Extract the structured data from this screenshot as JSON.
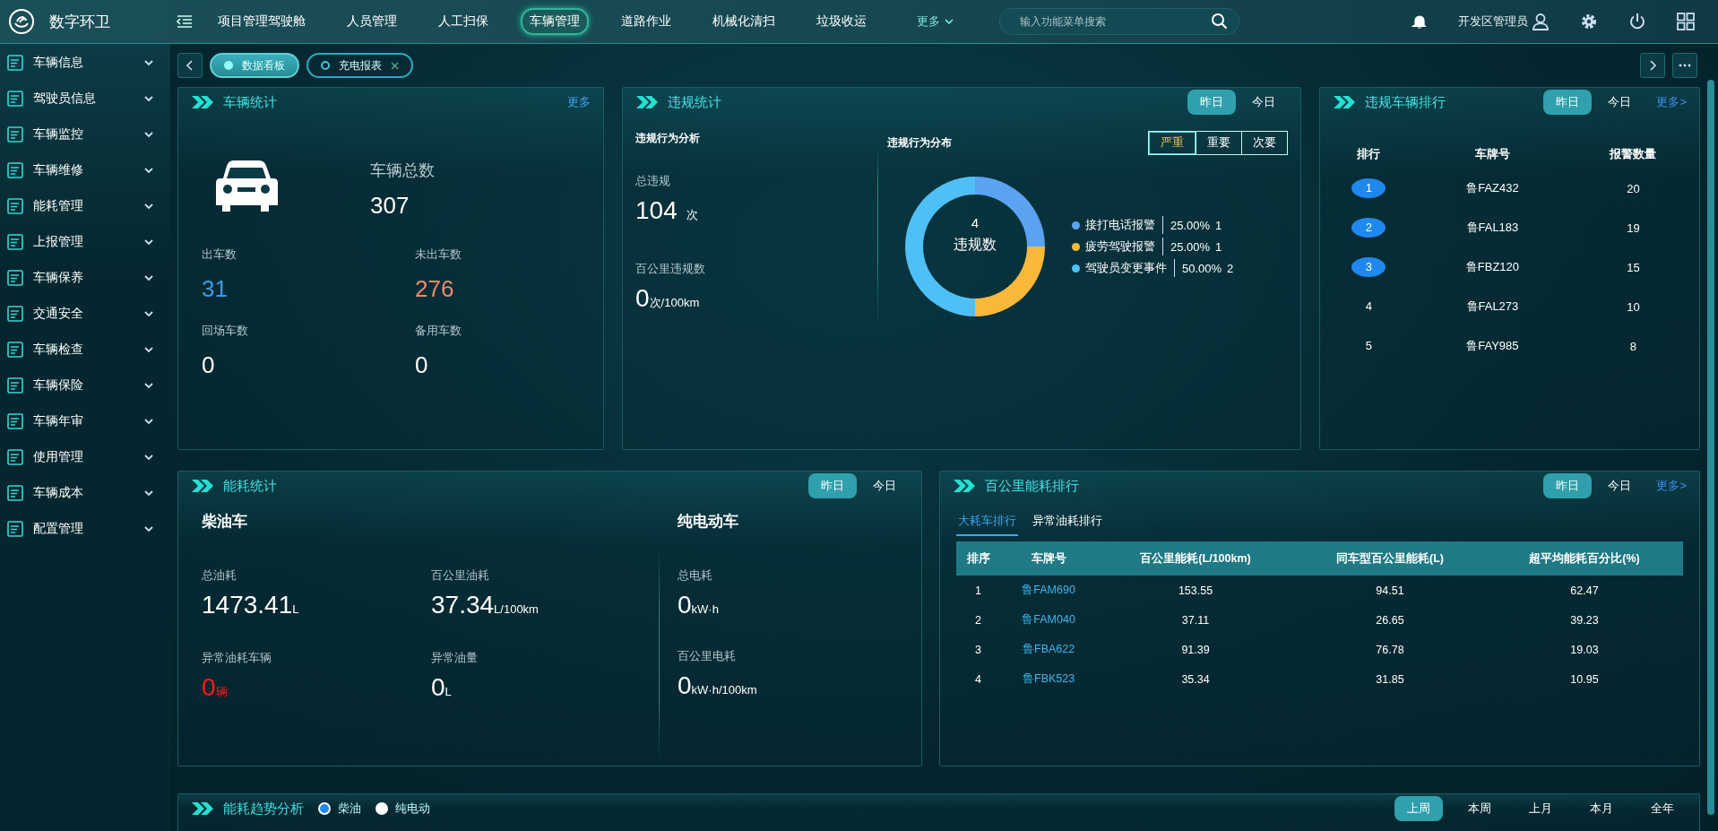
{
  "header": {
    "app_name": "数字环卫",
    "nav": [
      {
        "label": "项目管理驾驶舱",
        "selected": false
      },
      {
        "label": "人员管理",
        "selected": false
      },
      {
        "label": "人工扫保",
        "selected": false
      },
      {
        "label": "车辆管理",
        "selected": true
      },
      {
        "label": "道路作业",
        "selected": false
      },
      {
        "label": "机械化清扫",
        "selected": false
      },
      {
        "label": "垃圾收运",
        "selected": false
      }
    ],
    "more": "更多",
    "search": {
      "placeholder": "输入功能菜单搜索"
    },
    "user": "开发区管理员"
  },
  "sidebar": {
    "items": [
      {
        "label": "车辆信息"
      },
      {
        "label": "驾驶员信息"
      },
      {
        "label": "车辆监控"
      },
      {
        "label": "车辆维修"
      },
      {
        "label": "能耗管理"
      },
      {
        "label": "上报管理"
      },
      {
        "label": "车辆保养"
      },
      {
        "label": "交通安全"
      },
      {
        "label": "车辆检查"
      },
      {
        "label": "车辆保险"
      },
      {
        "label": "车辆年审"
      },
      {
        "label": "使用管理"
      },
      {
        "label": "车辆成本"
      },
      {
        "label": "配置管理"
      }
    ]
  },
  "page_tabs": [
    {
      "label": "数据看板",
      "selected": true
    },
    {
      "label": "充电报表",
      "selected": false
    }
  ],
  "vehicle_stats": {
    "title": "车辆统计",
    "more": "更多",
    "total_label": "车辆总数",
    "total_value": "307",
    "stats": [
      {
        "label": "出车数",
        "value": "31",
        "color": "#3a9be8"
      },
      {
        "label": "未出车数",
        "value": "276",
        "color": "#f08a6a"
      },
      {
        "label": "回场车数",
        "value": "0",
        "color": "#ffffff"
      },
      {
        "label": "备用车数",
        "value": "0",
        "color": "#ffffff"
      }
    ]
  },
  "violation_stats": {
    "title": "违规统计",
    "tabs": [
      {
        "label": "昨日",
        "selected": true
      },
      {
        "label": "今日",
        "selected": false
      }
    ],
    "analysis_title": "违规行为分析",
    "total_label": "总违规",
    "total_value": "104",
    "total_unit": "次",
    "per100_label": "百公里违规数",
    "per100_value": "0",
    "per100_unit": "次/100km",
    "distribution_title": "违规行为分布",
    "severity": [
      {
        "label": "严重",
        "selected": true
      },
      {
        "label": "重要",
        "selected": false
      },
      {
        "label": "次要",
        "selected": false
      }
    ],
    "center_value": "4",
    "center_label": "违规数",
    "chart_data": {
      "type": "donut",
      "categories": [
        "接打电话报警",
        "疲劳驾驶报警",
        "驾驶员变更事件"
      ],
      "values": [
        25,
        25,
        50
      ]
    },
    "legend": [
      {
        "percent": "25.00%",
        "count": "1",
        "color": "#5aa2f2"
      },
      {
        "percent": "25.00%",
        "count": "1",
        "color": "#f8b83a"
      },
      {
        "percent": "50.00%",
        "count": "2",
        "color": "#4fc0f6"
      }
    ]
  },
  "violation_ranking": {
    "title": "违规车辆排行",
    "tabs": [
      {
        "label": "昨日",
        "selected": true
      },
      {
        "label": "今日",
        "selected": false
      }
    ],
    "more": "更多>",
    "columns": [
      "排行",
      "车牌号",
      "报警数量"
    ],
    "rows": [
      {
        "rank": "1",
        "plate": "鲁FAZ432",
        "count": "20",
        "highlighted": true
      },
      {
        "rank": "2",
        "plate": "鲁FAL183",
        "count": "19",
        "highlighted": true
      },
      {
        "rank": "3",
        "plate": "鲁FBZ120",
        "count": "15",
        "highlighted": true
      },
      {
        "rank": "4",
        "plate": "鲁FAL273",
        "count": "10",
        "highlighted": false
      },
      {
        "rank": "5",
        "plate": "鲁FAY985",
        "count": "8",
        "highlighted": false
      }
    ]
  },
  "energy_stats": {
    "title": "能耗统计",
    "tabs": [
      {
        "label": "昨日",
        "selected": true
      },
      {
        "label": "今日",
        "selected": false
      }
    ],
    "diesel": {
      "title": "柴油车",
      "metrics": [
        {
          "label": "总油耗",
          "value": "1473.41",
          "unit": "L",
          "color": "#ffffff"
        },
        {
          "label": "百公里油耗",
          "value": "37.34",
          "unit": "L/100km",
          "color": "#ffffff"
        },
        {
          "label": "异常油耗车辆",
          "value": "0",
          "unit": "辆",
          "color": "#ff1a1a"
        },
        {
          "label": "异常油量",
          "value": "0",
          "unit": "L",
          "color": "#ffffff"
        }
      ]
    },
    "electric": {
      "title": "纯电动车",
      "metrics": [
        {
          "label": "总电耗",
          "value": "0",
          "unit": "kW·h",
          "color": "#ffffff"
        },
        {
          "label": "百公里电耗",
          "value": "0",
          "unit": "kW·h/100km",
          "color": "#ffffff"
        }
      ]
    }
  },
  "energy_ranking": {
    "title": "百公里能耗排行",
    "tabs": [
      {
        "label": "昨日",
        "selected": true
      },
      {
        "label": "今日",
        "selected": false
      }
    ],
    "more": "更多>",
    "subtabs": [
      {
        "label": "大耗车排行",
        "selected": true
      },
      {
        "label": "异常油耗排行",
        "selected": false
      }
    ],
    "columns": [
      "排序",
      "车牌号",
      "百公里能耗(L/100km)",
      "同车型百公里能耗(L)",
      "超平均能耗百分比(%)"
    ],
    "rows": [
      [
        "1",
        "鲁FAM690",
        "153.55",
        "94.51",
        "62.47"
      ],
      [
        "2",
        "鲁FAM040",
        "37.11",
        "26.65",
        "39.23"
      ],
      [
        "3",
        "鲁FBA622",
        "91.39",
        "76.78",
        "19.03"
      ],
      [
        "4",
        "鲁FBK523",
        "35.34",
        "31.85",
        "10.95"
      ]
    ]
  },
  "energy_trend": {
    "title": "能耗趋势分析",
    "options": [
      {
        "label": "柴油",
        "selected": true
      },
      {
        "label": "纯电动",
        "selected": false
      }
    ],
    "periods": [
      {
        "label": "上周",
        "selected": true
      },
      {
        "label": "本周",
        "selected": false
      },
      {
        "label": "上月",
        "selected": false
      },
      {
        "label": "本月",
        "selected": false
      },
      {
        "label": "全年",
        "selected": false
      }
    ]
  }
}
